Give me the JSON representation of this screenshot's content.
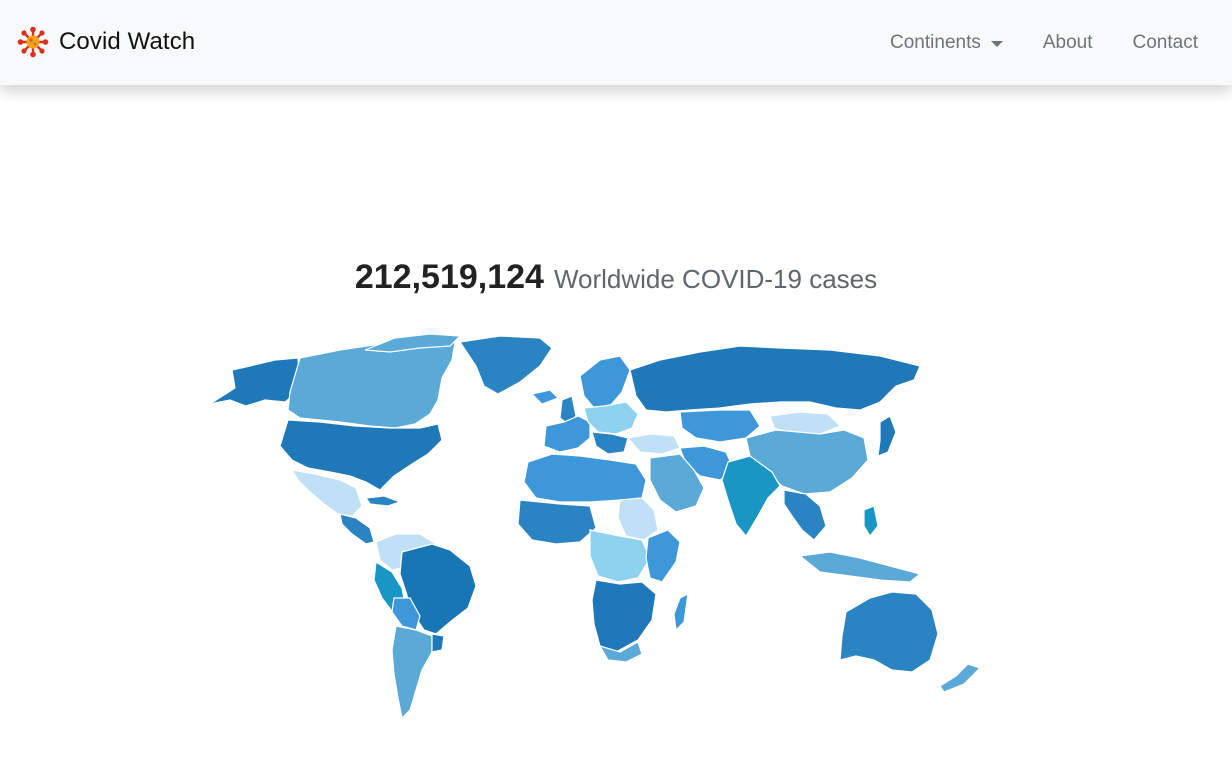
{
  "navbar": {
    "brand_icon": "virus-icon",
    "brand_title": "Covid Watch",
    "links": {
      "continents": "Continents",
      "about": "About",
      "contact": "Contact"
    }
  },
  "main": {
    "total_cases": "212,519,124",
    "cases_label": "Worldwide COVID-19 cases"
  },
  "map": {
    "color_scale": [
      "#bfe0f5",
      "#8fd2f0",
      "#5aa9d6",
      "#3d97d8",
      "#2b84c2",
      "#1f78b8",
      "#1976b4",
      "#1a96c4"
    ]
  }
}
